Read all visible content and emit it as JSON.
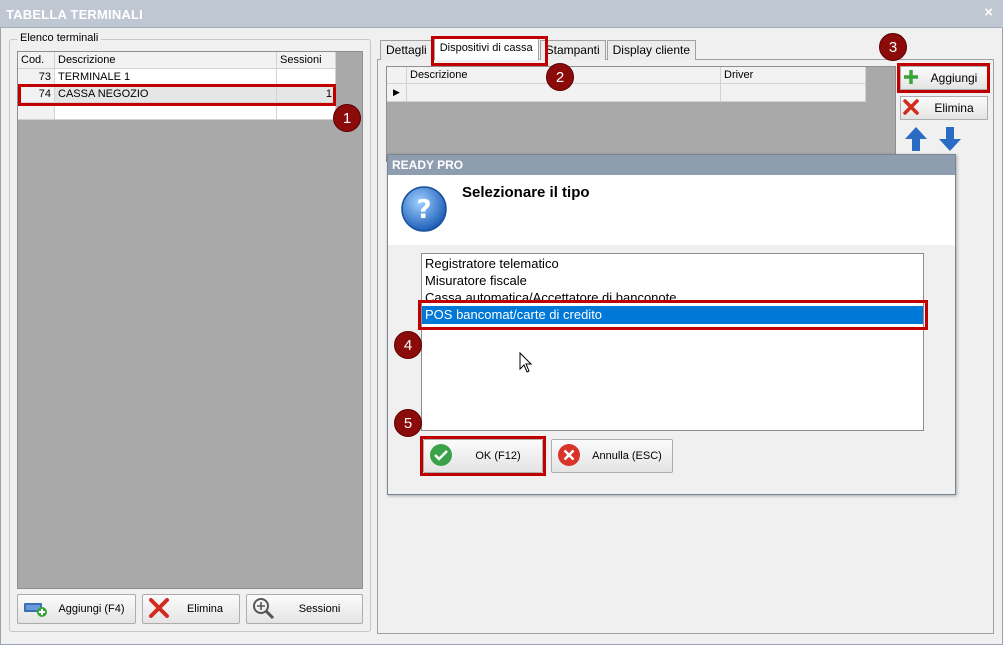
{
  "window": {
    "title": "TABELLA TERMINALI",
    "close": "×"
  },
  "left": {
    "group_label": "Elenco terminali",
    "columns": [
      "Cod.",
      "Descrizione",
      "Sessioni"
    ],
    "rows": [
      {
        "cod": "73",
        "descrizione": "TERMINALE 1",
        "sessioni": ""
      },
      {
        "cod": "74",
        "descrizione": "CASSA NEGOZIO",
        "sessioni": "1"
      }
    ],
    "buttons": {
      "add": "Aggiungi (F4)",
      "delete": "Elimina",
      "sessions": "Sessioni"
    }
  },
  "tabs": [
    "Dettagli",
    "Dispositivi di cassa",
    "Stampanti",
    "Display cliente"
  ],
  "right": {
    "columns": [
      "Descrizione",
      "Driver"
    ],
    "row_marker": "▶",
    "buttons": {
      "add": "Aggiungi",
      "delete": "Elimina"
    }
  },
  "dialog": {
    "title": "READY PRO",
    "heading": "Selezionare il tipo",
    "options": [
      "Registratore telematico",
      "Misuratore fiscale",
      "Cassa automatica/Accettatore di banconote",
      "POS bancomat/carte di credito"
    ],
    "selected_index": 3,
    "ok": "OK (F12)",
    "cancel": "Annulla (ESC)"
  },
  "badges": [
    "1",
    "2",
    "3",
    "4",
    "5"
  ],
  "colors": {
    "highlight": "#c00000",
    "badge": "#8b0a0a",
    "selection": "#0078d7",
    "title_bar": "#bfc7d3"
  }
}
